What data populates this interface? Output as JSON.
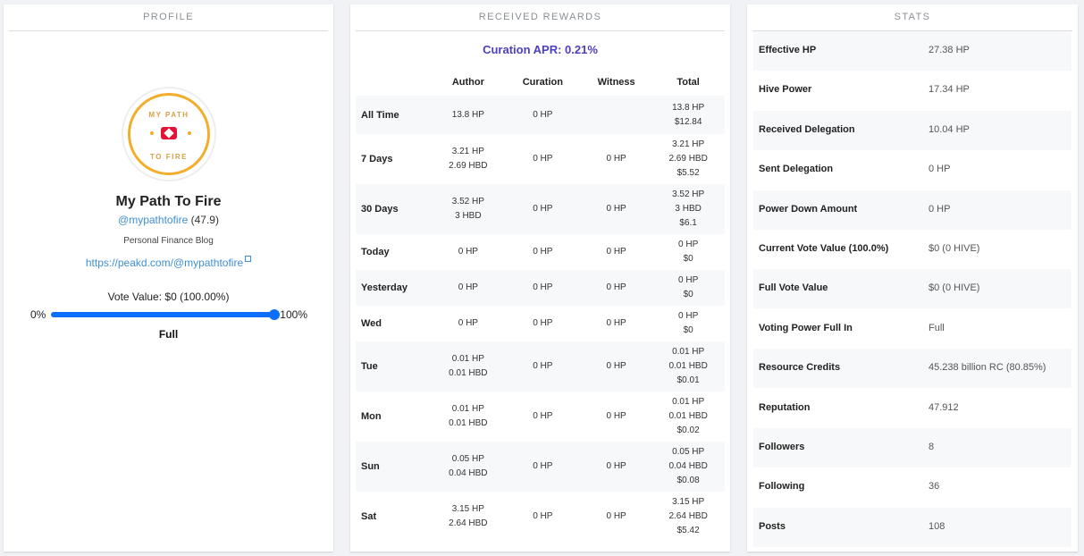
{
  "profile": {
    "section_title": "PROFILE",
    "avatar_top_text": "MY PATH",
    "avatar_bottom_text": "TO FIRE",
    "name": "My Path To Fire",
    "handle": "@mypathtofire",
    "reputation": "(47.9)",
    "about": "Personal Finance Blog",
    "website": "https://peakd.com/@mypathtofire",
    "vote_value": "Vote Value: $0 (100.00%)",
    "slider_min": "0%",
    "slider_max": "100%",
    "slider_value": 1.0,
    "status": "Full"
  },
  "rewards": {
    "section_title": "RECEIVED REWARDS",
    "curation_apr": "Curation APR: 0.21%",
    "headers": [
      "",
      "Author",
      "Curation",
      "Witness",
      "Total"
    ],
    "rows": [
      {
        "label": "All Time",
        "author": [
          "13.8 HP"
        ],
        "curation": "0 HP",
        "witness": "",
        "total": [
          "13.8 HP",
          "$12.84"
        ]
      },
      {
        "label": "7 Days",
        "author": [
          "3.21 HP",
          "2.69 HBD"
        ],
        "curation": "0 HP",
        "witness": "0 HP",
        "total": [
          "3.21 HP",
          "2.69 HBD",
          "$5.52"
        ]
      },
      {
        "label": "30 Days",
        "author": [
          "3.52 HP",
          "3 HBD"
        ],
        "curation": "0 HP",
        "witness": "0 HP",
        "total": [
          "3.52 HP",
          "3 HBD",
          "$6.1"
        ]
      },
      {
        "label": "Today",
        "author": [
          "0 HP"
        ],
        "curation": "0 HP",
        "witness": "0 HP",
        "total": [
          "0 HP",
          "$0"
        ]
      },
      {
        "label": "Yesterday",
        "author": [
          "0 HP"
        ],
        "curation": "0 HP",
        "witness": "0 HP",
        "total": [
          "0 HP",
          "$0"
        ]
      },
      {
        "label": "Wed",
        "author": [
          "0 HP"
        ],
        "curation": "0 HP",
        "witness": "0 HP",
        "total": [
          "0 HP",
          "$0"
        ]
      },
      {
        "label": "Tue",
        "author": [
          "0.01 HP",
          "0.01 HBD"
        ],
        "curation": "0 HP",
        "witness": "0 HP",
        "total": [
          "0.01 HP",
          "0.01 HBD",
          "$0.01"
        ]
      },
      {
        "label": "Mon",
        "author": [
          "0.01 HP",
          "0.01 HBD"
        ],
        "curation": "0 HP",
        "witness": "0 HP",
        "total": [
          "0.01 HP",
          "0.01 HBD",
          "$0.02"
        ]
      },
      {
        "label": "Sun",
        "author": [
          "0.05 HP",
          "0.04 HBD"
        ],
        "curation": "0 HP",
        "witness": "0 HP",
        "total": [
          "0.05 HP",
          "0.04 HBD",
          "$0.08"
        ]
      },
      {
        "label": "Sat",
        "author": [
          "3.15 HP",
          "2.64 HBD"
        ],
        "curation": "0 HP",
        "witness": "0 HP",
        "total": [
          "3.15 HP",
          "2.64 HBD",
          "$5.42"
        ]
      }
    ]
  },
  "stats": {
    "section_title": "STATS",
    "rows": [
      {
        "label": "Effective HP",
        "value": "27.38 HP"
      },
      {
        "label": "Hive Power",
        "value": "17.34 HP"
      },
      {
        "label": "Received Delegation",
        "value": "10.04 HP"
      },
      {
        "label": "Sent Delegation",
        "value": "0 HP"
      },
      {
        "label": "Power Down Amount",
        "value": "0 HP"
      },
      {
        "label": "Current Vote Value (100.0%)",
        "value": "$0 (0 HIVE)"
      },
      {
        "label": "Full Vote Value",
        "value": "$0 (0 HIVE)"
      },
      {
        "label": "Voting Power Full In",
        "value": "Full"
      },
      {
        "label": "Resource Credits",
        "value": "45.238 billion RC (80.85%)"
      },
      {
        "label": "Reputation",
        "value": "47.912"
      },
      {
        "label": "Followers",
        "value": "8"
      },
      {
        "label": "Following",
        "value": "36"
      },
      {
        "label": "Posts",
        "value": "108"
      }
    ]
  }
}
